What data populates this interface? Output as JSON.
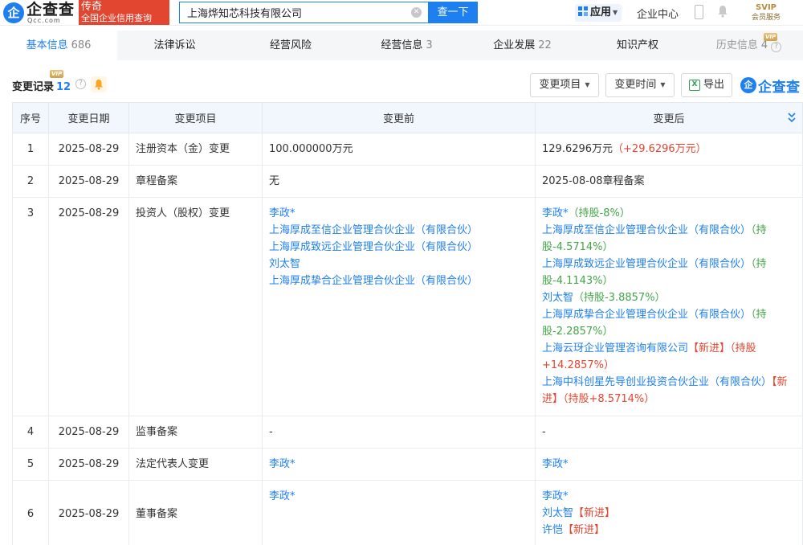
{
  "header": {
    "logo_mark": "企",
    "logo_text": "企查查",
    "logo_sub": "Qcc.com",
    "badge_line1": "传奇",
    "badge_line2": "全国企业信用查询",
    "search_value": "上海烨知芯科技有限公司",
    "search_button": "查一下",
    "apps_label": "应用",
    "enterprise_center": "企业中心",
    "svip_label": "SVIP",
    "member_service": "会员服务"
  },
  "tabs": [
    {
      "label": "基本信息",
      "count": "686"
    },
    {
      "label": "法律诉讼",
      "count": ""
    },
    {
      "label": "经营风险",
      "count": ""
    },
    {
      "label": "经营信息",
      "count": "3"
    },
    {
      "label": "企业发展",
      "count": "22"
    },
    {
      "label": "知识产权",
      "count": ""
    },
    {
      "label": "历史信息",
      "count": "4"
    }
  ],
  "vip_tag": "VIP",
  "section": {
    "title": "变更记录",
    "count": "12",
    "filter_item": "变更项目",
    "filter_time": "变更时间",
    "export": "导出",
    "watermark": "企查查"
  },
  "table": {
    "headers": [
      "序号",
      "变更日期",
      "变更项目",
      "变更前",
      "变更后"
    ],
    "rows": [
      {
        "idx": "1",
        "date": "2025-08-29",
        "item": "注册资本（金）变更",
        "before": "100.000000万元",
        "after": "129.6296万元",
        "after_delta": "（+29.6296万元）"
      },
      {
        "idx": "2",
        "date": "2025-08-29",
        "item": "章程备案",
        "before": "无",
        "after": "2025-08-08章程备案"
      },
      {
        "idx": "3",
        "date": "2025-08-29",
        "item": "投资人（股权）变更",
        "before_lines": [
          "李政*",
          "上海厚成至信企业管理合伙企业（有限合伙）",
          "上海厚成致远企业管理合伙企业（有限合伙）",
          "刘太智",
          "上海厚成挚合企业管理合伙企业（有限合伙）"
        ],
        "after_lines": [
          {
            "name": "李政*",
            "tag": "",
            "share": "（持股-8%）"
          },
          {
            "name": "上海厚成至信企业管理合伙企业（有限合伙）",
            "tag": "",
            "share": "（持股-4.5714%）"
          },
          {
            "name": "上海厚成致远企业管理合伙企业（有限合伙）",
            "tag": "",
            "share": "（持股-4.1143%）"
          },
          {
            "name": "刘太智",
            "tag": "",
            "share": "（持股-3.8857%）"
          },
          {
            "name": "上海厚成挚合企业管理合伙企业（有限合伙）",
            "tag": "",
            "share": "（持股-2.2857%）"
          },
          {
            "name": "上海云玡企业管理咨询有限公司",
            "tag": "【新进】",
            "share": "（持股+14.2857%）"
          },
          {
            "name": "上海中科创星先导创业投资合伙企业（有限合伙）",
            "tag": "【新进】",
            "share": "（持股+8.5714%）"
          }
        ]
      },
      {
        "idx": "4",
        "date": "2025-08-29",
        "item": "监事备案",
        "before": "-",
        "after": "-"
      },
      {
        "idx": "5",
        "date": "2025-08-29",
        "item": "法定代表人变更",
        "before": "李政*",
        "after": "李政*"
      },
      {
        "idx": "6",
        "date": "2025-08-29",
        "item": "董事备案",
        "before": "李政*",
        "after_lines": [
          {
            "name": "李政*",
            "tag": ""
          },
          {
            "name": "刘太智",
            "tag": "【新进】"
          },
          {
            "name": "许恺",
            "tag": "【新进】"
          }
        ]
      }
    ]
  },
  "colors": {
    "brand_blue": "#1e7ff0",
    "badge_red": "#e24530",
    "share_green": "#42a548",
    "header_bg": "#f2f7fd"
  },
  "icons": [
    "search-clear-icon",
    "apps-grid-icon",
    "phone-icon",
    "bell-icon",
    "info-icon",
    "excel-icon",
    "collapse-icon"
  ]
}
